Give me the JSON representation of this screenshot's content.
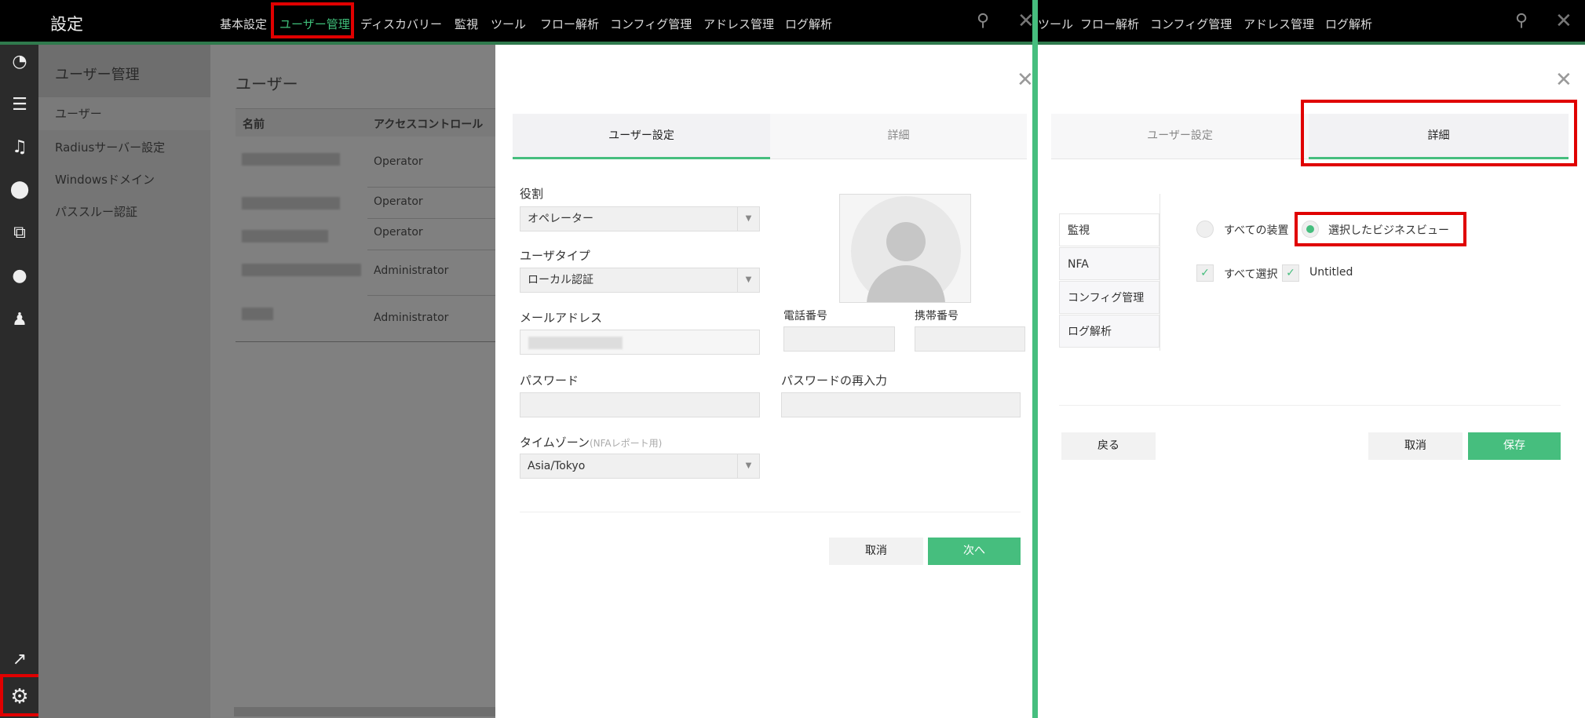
{
  "header": {
    "title": "設定",
    "nav": [
      "基本設定",
      "ユーザー管理",
      "ディスカバリー",
      "監視",
      "ツール",
      "フロー解析",
      "コンフィグ管理",
      "アドレス管理",
      "ログ解析"
    ],
    "active_nav": "ユーザー管理",
    "right_nav": [
      "ツール",
      "フロー解析",
      "コンフィグ管理",
      "アドレス管理",
      "ログ解析"
    ]
  },
  "submenu": {
    "title": "ユーザー管理",
    "items": [
      "ユーザー",
      "Radiusサーバー設定",
      "Windowsドメイン",
      "パススルー認証"
    ]
  },
  "content": {
    "title": "ユーザー",
    "columns": [
      "名前",
      "アクセスコントロール"
    ],
    "rows": [
      {
        "access": "Operator"
      },
      {
        "access": "Operator"
      },
      {
        "access": "Operator"
      },
      {
        "access": "Administrator"
      },
      {
        "access": "Administrator"
      }
    ]
  },
  "modal": {
    "tabs": [
      "ユーザー設定",
      "詳細"
    ],
    "role_label": "役割",
    "role_value": "オペレーター",
    "usertype_label": "ユーザタイプ",
    "usertype_value": "ローカル認証",
    "email_label": "メールアドレス",
    "phone_label": "電話番号",
    "mobile_label": "携帯番号",
    "password_label": "パスワード",
    "password_confirm_label": "パスワードの再入力",
    "timezone_label": "タイムゾーン",
    "timezone_note": "(NFAレポート用)",
    "timezone_value": "Asia/Tokyo",
    "cancel": "取消",
    "next": "次へ"
  },
  "detail": {
    "tabs": [
      "ユーザー設定",
      "詳細"
    ],
    "sections": [
      "監視",
      "NFA",
      "コンフィグ管理",
      "ログ解析"
    ],
    "radio_all": "すべての装置",
    "radio_selected": "選択したビジネスビュー",
    "check_all": "すべて選択",
    "check_item": "Untitled",
    "back": "戻る",
    "cancel": "取消",
    "save": "保存"
  },
  "colors": {
    "accent": "#46be7e",
    "highlight": "#e00000"
  }
}
